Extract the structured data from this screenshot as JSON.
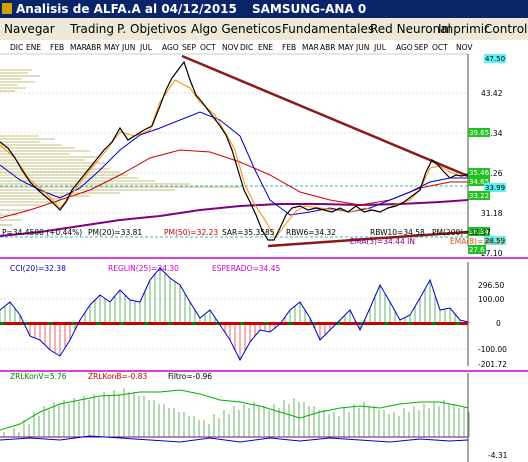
{
  "window": {
    "title": "Analisis de ALFA.A al 04/12/2015",
    "subtitle": "SAMSUNG-ANA 0"
  },
  "menu": [
    "Navegar",
    "Trading",
    "P. Objetivos",
    "Algo Geneticos",
    "Fundamentales",
    "Red Neuronal",
    "Imprimir",
    "Controles"
  ],
  "colors": {
    "title_bar": "#0a246a",
    "price_line": "#000000",
    "ema3": "#ff8c00",
    "ma20": "#0000cc",
    "ma50": "#cc0000",
    "ma200": "#800080",
    "trend_line": "#8b1a1a",
    "volume_profile": "#8b8000",
    "osc_green": "#008000",
    "osc_red": "#cc0000"
  },
  "price_panel": {
    "months": [
      "DIC",
      "ENE",
      "FEB",
      "MAR",
      "ABR",
      "MAY",
      "JUN",
      "JUL",
      "AGO",
      "SEP",
      "OCT",
      "NOV",
      "DIC",
      "ENE",
      "FEB",
      "MAR",
      "ABR",
      "MAY",
      "JUN",
      "JUL",
      "AGO",
      "SEP",
      "OCT",
      "NOV"
    ],
    "y_axis_labels": [
      "47.50",
      "43.42",
      "39.34",
      "35.26",
      "31.18",
      "27.10"
    ],
    "price_tags": [
      "39.65",
      "35.46",
      "34.65",
      "33.99",
      "33.22",
      "30.34",
      "28.59",
      "27.6"
    ],
    "stats_left": "P=34.4500 (+0.44%)",
    "stat_pm20": "PM(20)=33.81",
    "stat_pm50": "PM(50)=32.23",
    "stat_sar": "SAR=35.3585",
    "stat_rbw6": "RBW6=34.32",
    "stat_rbw10": "RBW10=34.58",
    "stat_pm200": "PM(200)=32.37",
    "stat_ema3": "EMA(3)=34.44 IN",
    "stat_ema8": "EMA(8)=34.33"
  },
  "osc_panel": {
    "cci": "CCI(20)=32.38",
    "reglin": "REGLIN(25)=34.30",
    "esperado": "ESPERADO=34.45",
    "y_axis_labels": [
      "296.50",
      "100.00",
      "0",
      "-100.00",
      "-201.72"
    ]
  },
  "zrl_panel": {
    "konv": "ZRLKonV=5.76",
    "konb": "ZRLKonB=-0.83",
    "filtro": "Filtro=-0.96",
    "y_axis_labels": [
      "-4.31"
    ]
  }
}
